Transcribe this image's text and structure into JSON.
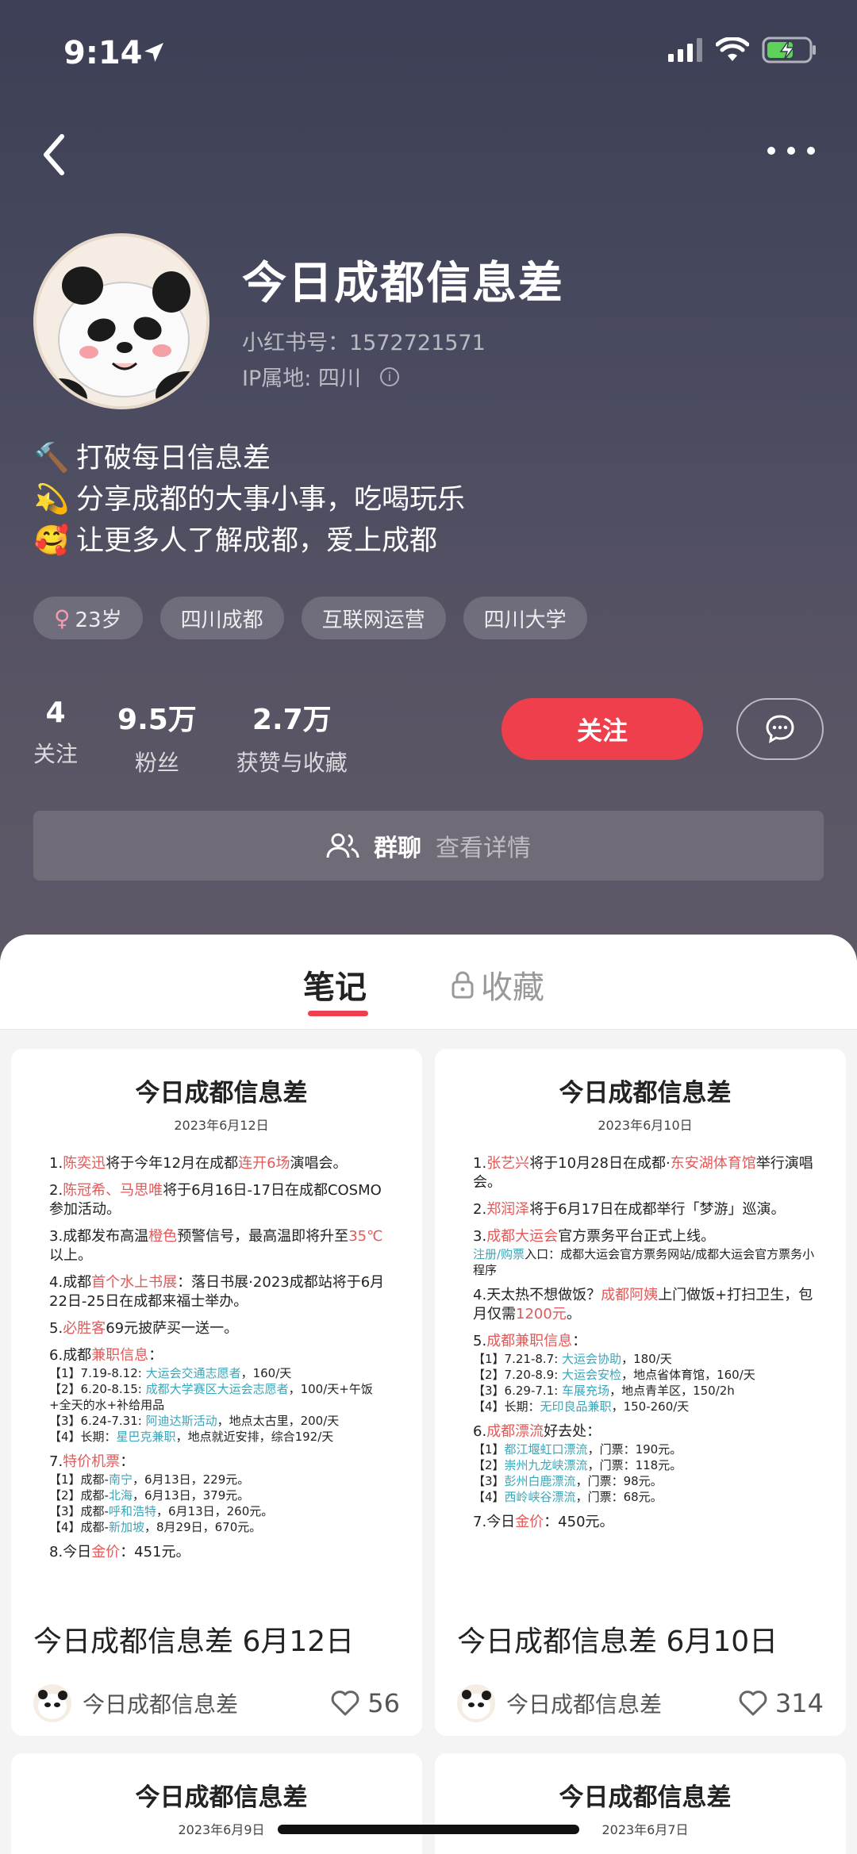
{
  "status_bar": {
    "time": "9:14"
  },
  "profile": {
    "name": "今日成都信息差",
    "user_id": "小红书号：1572721571",
    "ip_location": "IP属地: 四川",
    "bio": [
      {
        "emoji": "🔨",
        "text": "打破每日信息差"
      },
      {
        "emoji": "💫",
        "text": "分享成都的大事小事，吃喝玩乐"
      },
      {
        "emoji": "🥰",
        "text": "让更多人了解成都，爱上成都"
      }
    ],
    "tags": [
      "23岁",
      "四川成都",
      "互联网运营",
      "四川大学"
    ],
    "stats": [
      {
        "value": "4",
        "label": "关注"
      },
      {
        "value": "9.5万",
        "label": "粉丝"
      },
      {
        "value": "2.7万",
        "label": "获赞与收藏"
      }
    ],
    "follow_label": "关注",
    "group": {
      "title": "群聊",
      "detail": "查看详情"
    }
  },
  "tabs": {
    "notes": "笔记",
    "favorites": "收藏"
  },
  "cards": [
    {
      "poster_title": "今日成都信息差",
      "poster_date": "2023年6月12日",
      "items": [
        {
          "n": "1.",
          "parts": [
            [
              "陈奕迅",
              "red"
            ],
            [
              "将于今年12月在成都",
              ""
            ],
            [
              "连开6场",
              "red"
            ],
            [
              "演唱会。",
              ""
            ]
          ]
        },
        {
          "n": "2.",
          "parts": [
            [
              "陈冠希、马思唯",
              "red"
            ],
            [
              "将于6月16日-17日在成都COSMO参加活动。",
              ""
            ]
          ]
        },
        {
          "n": "3.",
          "parts": [
            [
              "成都发布高温",
              ""
            ],
            [
              "橙色",
              "red"
            ],
            [
              "预警信号，最高温即将升至",
              ""
            ],
            [
              "35℃",
              "red"
            ],
            [
              "以上。",
              ""
            ]
          ]
        },
        {
          "n": "4.",
          "parts": [
            [
              "成都",
              ""
            ],
            [
              "首个水上书展",
              "red"
            ],
            [
              "：落日书展·2023成都站将于6月22日-25日在成都来福士举办。",
              ""
            ]
          ]
        },
        {
          "n": "5.",
          "parts": [
            [
              "必胜客",
              "red"
            ],
            [
              "69元披萨买一送一。",
              ""
            ]
          ]
        },
        {
          "n": "6.",
          "parts": [
            [
              "成都",
              ""
            ],
            [
              "兼职信息",
              "red"
            ],
            [
              "：",
              ""
            ]
          ],
          "sub": [
            [
              [
                "【1】7.19-8.12: ",
                ""
              ],
              [
                "大运会交通志愿者",
                "blue"
              ],
              [
                "，160/天",
                ""
              ]
            ],
            [
              [
                "【2】6.20-8.15: ",
                ""
              ],
              [
                "成都大学赛区大运会志愿者",
                "blue"
              ],
              [
                "，100/天+午饭+全天的水+补给用品",
                ""
              ]
            ],
            [
              [
                "【3】6.24-7.31: ",
                ""
              ],
              [
                "阿迪达斯活动",
                "blue"
              ],
              [
                "，地点太古里，200/天",
                ""
              ]
            ],
            [
              [
                "【4】长期：",
                ""
              ],
              [
                "星巴克兼职",
                "blue"
              ],
              [
                "，地点就近安排，综合192/天",
                ""
              ]
            ]
          ]
        },
        {
          "n": "7.",
          "parts": [
            [
              "特价机票",
              "red"
            ],
            [
              "：",
              ""
            ]
          ],
          "sub": [
            [
              [
                "【1】成都-",
                ""
              ],
              [
                "南宁",
                "blue"
              ],
              [
                "，6月13日，229元。",
                ""
              ]
            ],
            [
              [
                "【2】成都-",
                ""
              ],
              [
                "北海",
                "blue"
              ],
              [
                "，6月13日，379元。",
                ""
              ]
            ],
            [
              [
                "【3】成都-",
                ""
              ],
              [
                "呼和浩特",
                "blue"
              ],
              [
                "，6月13日，260元。",
                ""
              ]
            ],
            [
              [
                "【4】成都-",
                ""
              ],
              [
                "新加坡",
                "blue"
              ],
              [
                "，8月29日，670元。",
                ""
              ]
            ]
          ]
        },
        {
          "n": "8.",
          "parts": [
            [
              "今日",
              ""
            ],
            [
              "金价",
              "red"
            ],
            [
              "：451元。",
              ""
            ]
          ]
        }
      ],
      "title": "今日成都信息差 6月12日",
      "author": "今日成都信息差",
      "likes": "56"
    },
    {
      "poster_title": "今日成都信息差",
      "poster_date": "2023年6月10日",
      "items": [
        {
          "n": "1.",
          "parts": [
            [
              "张艺兴",
              "red"
            ],
            [
              "将于10月28日在成都·",
              ""
            ],
            [
              "东安湖体育馆",
              "red"
            ],
            [
              "举行演唱会。",
              ""
            ]
          ]
        },
        {
          "n": "2.",
          "parts": [
            [
              "郑润泽",
              "red"
            ],
            [
              "将于6月17日在成都举行「梦游」巡演。",
              ""
            ]
          ]
        },
        {
          "n": "3.",
          "parts": [
            [
              "成都大运会",
              "red"
            ],
            [
              "官方票务平台正式上线。",
              ""
            ]
          ],
          "sub": [
            [
              [
                "注册/购票",
                "blue"
              ],
              [
                "入口：成都大运会官方票务网站/成都大运会官方票务小程序",
                ""
              ]
            ]
          ]
        },
        {
          "n": "4.",
          "parts": [
            [
              "天太热不想做饭？",
              ""
            ],
            [
              "成都阿姨",
              "red"
            ],
            [
              "上门做饭+打扫卫生，包月仅需",
              ""
            ],
            [
              "1200元",
              "red"
            ],
            [
              "。",
              ""
            ]
          ]
        },
        {
          "n": "5.",
          "parts": [
            [
              "成都兼职信息",
              "red"
            ],
            [
              "：",
              ""
            ]
          ],
          "sub": [
            [
              [
                "【1】7.21-8.7: ",
                ""
              ],
              [
                "大运会协助",
                "blue"
              ],
              [
                "，180/天",
                ""
              ]
            ],
            [
              [
                "【2】7.20-8.9: ",
                ""
              ],
              [
                "大运会安检",
                "blue"
              ],
              [
                "，地点省体育馆，160/天",
                ""
              ]
            ],
            [
              [
                "【3】6.29-7.1: ",
                ""
              ],
              [
                "车展充场",
                "blue"
              ],
              [
                "，地点青羊区，150/2h",
                ""
              ]
            ],
            [
              [
                "【4】长期：",
                ""
              ],
              [
                "无印良品兼职",
                "blue"
              ],
              [
                "，150-260/天",
                ""
              ]
            ]
          ]
        },
        {
          "n": "6.",
          "parts": [
            [
              "成都漂流",
              "red"
            ],
            [
              "好去处：",
              ""
            ]
          ],
          "sub": [
            [
              [
                "【1】",
                ""
              ],
              [
                "都江堰虹口漂流",
                "blue"
              ],
              [
                "，门票：190元。",
                ""
              ]
            ],
            [
              [
                "【2】",
                ""
              ],
              [
                "崇州九龙峡漂流",
                "blue"
              ],
              [
                "，门票：118元。",
                ""
              ]
            ],
            [
              [
                "【3】",
                ""
              ],
              [
                "彭州白鹿漂流",
                "blue"
              ],
              [
                "，门票：98元。",
                ""
              ]
            ],
            [
              [
                "【4】",
                ""
              ],
              [
                "西岭峡谷漂流",
                "blue"
              ],
              [
                "，门票：68元。",
                ""
              ]
            ]
          ]
        },
        {
          "n": "7.",
          "parts": [
            [
              "今日",
              ""
            ],
            [
              "金价",
              "red"
            ],
            [
              "：450元。",
              ""
            ]
          ]
        }
      ],
      "title": "今日成都信息差 6月10日",
      "author": "今日成都信息差",
      "likes": "314"
    },
    {
      "poster_title": "今日成都信息差",
      "poster_date": "2023年6月9日"
    },
    {
      "poster_title": "今日成都信息差",
      "poster_date": "2023年6月7日"
    }
  ]
}
